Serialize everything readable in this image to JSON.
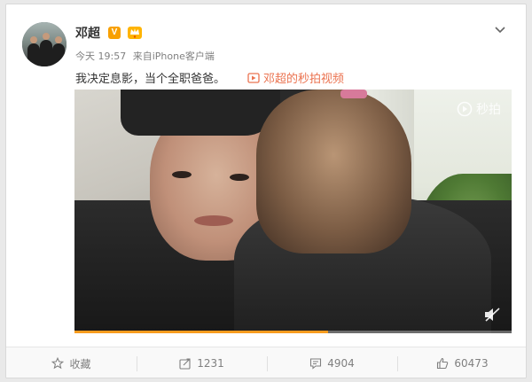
{
  "post": {
    "author": "邓超",
    "vip_badge": "V",
    "meta": {
      "time": "今天 19:57",
      "source_prefix": "来自",
      "source": "iPhone客户端"
    },
    "text": "我决定息影，当个全职爸爸。",
    "video_link": "邓超的秒拍视频",
    "video": {
      "watermark": "秒拍",
      "progress": 0.58
    }
  },
  "actions": [
    {
      "label": "收藏",
      "icon": "star-icon"
    },
    {
      "label": "1231",
      "icon": "share-icon"
    },
    {
      "label": "4904",
      "icon": "comment-icon"
    },
    {
      "label": "60473",
      "icon": "thumbs-up-icon"
    }
  ],
  "colors": {
    "accent": "#eb7350",
    "vip": "#f8a000",
    "progress": "#f89c1f"
  }
}
